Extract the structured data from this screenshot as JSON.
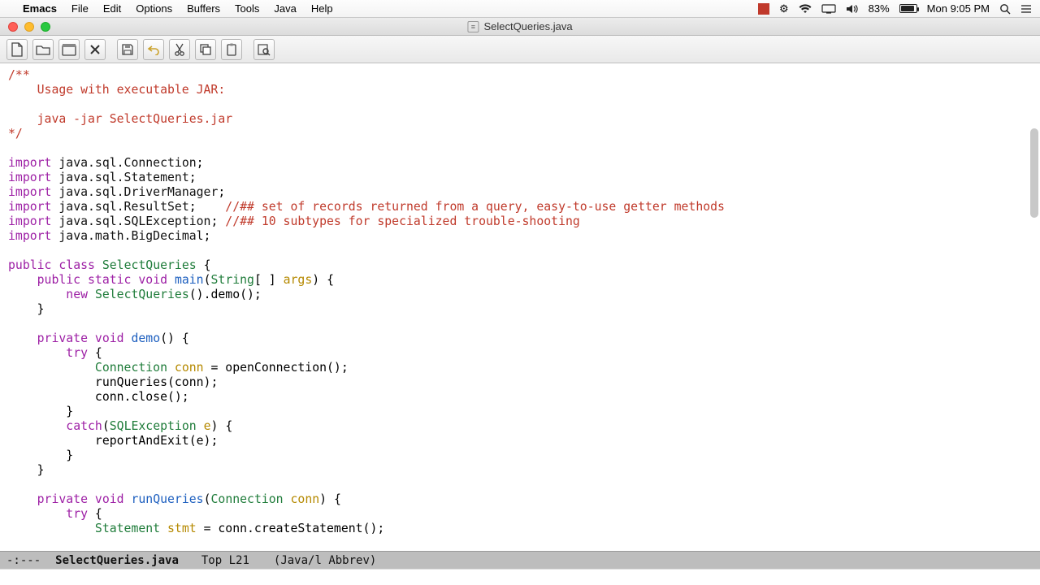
{
  "menubar": {
    "app": "Emacs",
    "items": [
      "File",
      "Edit",
      "Options",
      "Buffers",
      "Tools",
      "Java",
      "Help"
    ],
    "battery_pct": "83%",
    "clock": "Mon 9:05 PM"
  },
  "window": {
    "title": "SelectQueries.java"
  },
  "toolbar": {
    "new": "new-file",
    "open": "open-file",
    "dired": "dired",
    "close": "close-buffer",
    "save": "save",
    "undo": "undo",
    "cut": "cut",
    "copy": "copy",
    "paste": "paste",
    "search": "search"
  },
  "modeline": {
    "left": "-:---",
    "buffer": "SelectQueries.java",
    "position": "Top L21",
    "mode": "(Java/l Abbrev)"
  },
  "code": {
    "c1": "/**",
    "c2": "    Usage with executable JAR:",
    "c3": "",
    "c4": "    java -jar SelectQueries.jar",
    "c5": "*/",
    "imp": "import",
    "pkg_conn": "java.sql.Connection",
    "pkg_stmt": "java.sql.Statement",
    "pkg_drv": "java.sql.DriverManager",
    "pkg_rs": "java.sql.ResultSet",
    "pkg_sqle": "java.sql.SQLException",
    "pkg_bd": "java.math.BigDecimal",
    "rs_cmt": "//## set of records returned from a query, easy-to-use getter methods",
    "sqle_cmt": "//## 10 subtypes for specialized trouble-shooting",
    "public": "public",
    "class": "class",
    "cls_name": "SelectQueries",
    "static": "static",
    "void": "void",
    "main": "main",
    "string": "String",
    "args": "args",
    "new": "new",
    "demo_call": "().demo();",
    "private": "private",
    "demo": "demo",
    "try": "try",
    "Connection": "Connection",
    "conn": "conn",
    "eq_open": " = openConnection();",
    "runQ_call": "runQueries(conn);",
    "conn_close": "conn.close();",
    "catch": "catch",
    "SQLException": "SQLException",
    "e": "e",
    "report": "reportAndExit(e);",
    "runQueries": "runQueries",
    "Statement": "Statement",
    "stmt": "stmt",
    "eq_create": " = conn.createStatement();"
  }
}
